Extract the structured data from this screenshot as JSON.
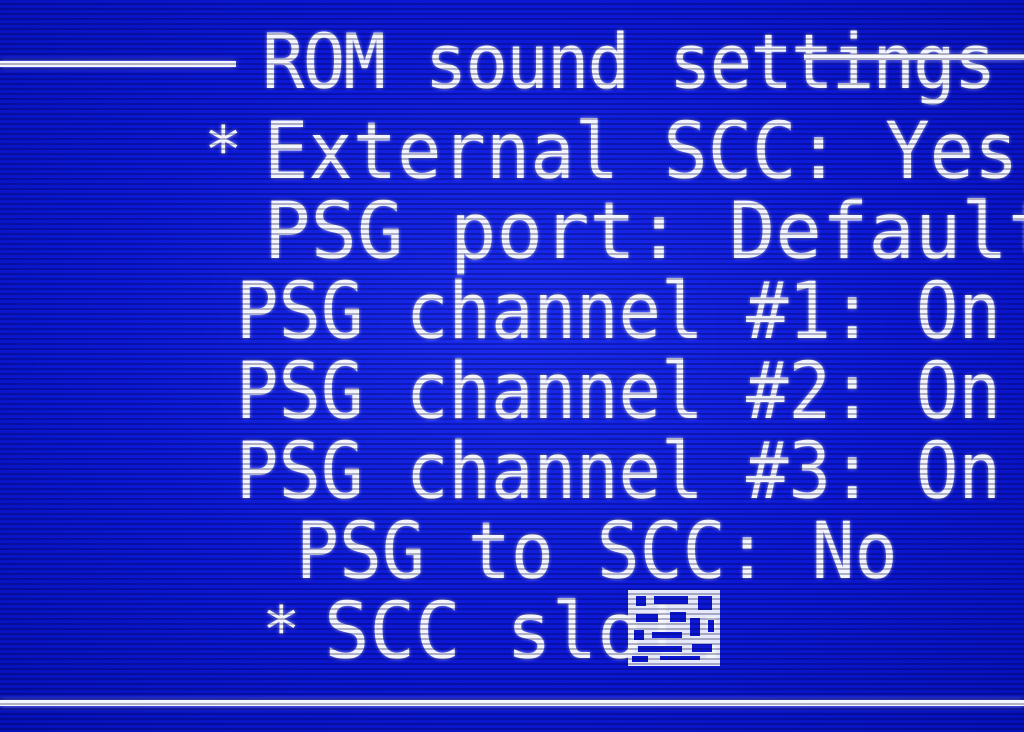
{
  "menu": {
    "title": "ROM sound settings",
    "items": [
      {
        "cursor": "*",
        "label": "External SCC: Yes",
        "selected": true
      },
      {
        "cursor": "",
        "label": "PSG port: Default",
        "selected": false
      },
      {
        "cursor": "",
        "label": "PSG channel #1: On",
        "selected": false
      },
      {
        "cursor": "",
        "label": "PSG channel #2: On",
        "selected": false
      },
      {
        "cursor": "",
        "label": "PSG channel #3: On",
        "selected": false
      },
      {
        "cursor": "",
        "label": "PSG to SCC: No",
        "selected": false
      },
      {
        "cursor": "*",
        "label": "SCC slot: ",
        "selected": false
      }
    ]
  },
  "colors": {
    "background": "#0c18d6",
    "text": "#f2f4ff"
  },
  "icons": {
    "slot_value": "scc-slot-glyph-icon"
  }
}
